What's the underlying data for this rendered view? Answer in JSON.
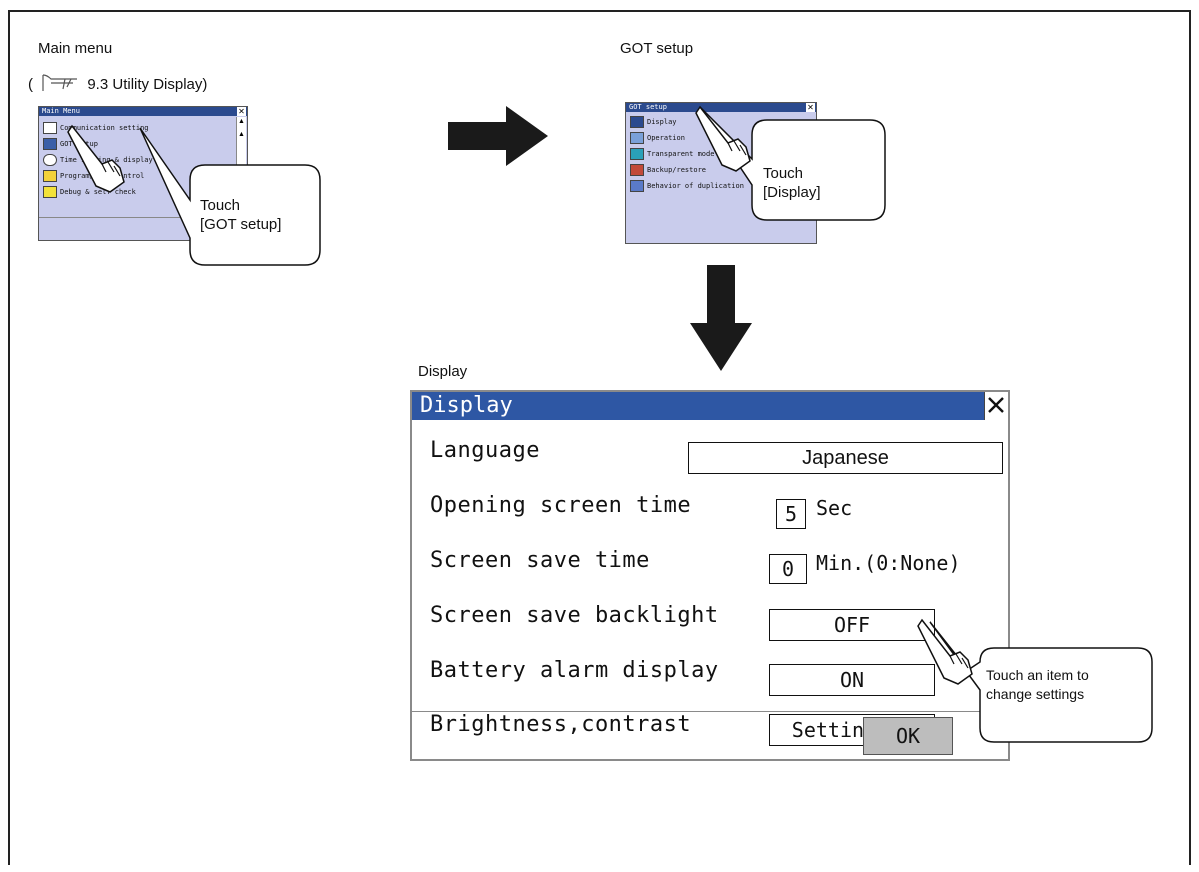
{
  "captions": {
    "main_menu": "Main menu",
    "ref_prefix": "(",
    "ref_text": "9.3 Utility Display)",
    "got_setup": "GOT setup",
    "display": "Display"
  },
  "main_menu_thumb": {
    "title": "Main Menu",
    "items": [
      "Communication setting",
      "GOT setup",
      "Time setting & display",
      "Program/Data control",
      "Debug & self check"
    ],
    "callout": [
      "Touch",
      "[GOT setup]"
    ]
  },
  "got_setup_thumb": {
    "title": "GOT setup",
    "items": [
      "Display",
      "Operation",
      "Transparent mode",
      "Backup/restore",
      "Behavior of duplication"
    ],
    "callout": [
      "Touch",
      "[Display]"
    ]
  },
  "display_dialog": {
    "title": "Display",
    "rows": {
      "language": {
        "label": "Language",
        "value": "Japanese"
      },
      "opening": {
        "label": "Opening screen time",
        "value": "5",
        "unit": "Sec"
      },
      "save_time": {
        "label": "Screen save time",
        "value": "0",
        "unit": "Min.(0:None)"
      },
      "backlight": {
        "label": "Screen save backlight",
        "value": "OFF"
      },
      "battery": {
        "label": "Battery alarm display",
        "value": "ON"
      },
      "brightness": {
        "label": "Brightness,contrast",
        "value": "Setting..."
      }
    },
    "ok_label": "OK",
    "callout": [
      "Touch an item to",
      "change settings"
    ]
  },
  "colors": {
    "title_bar": "#2e57a4",
    "thumb_bg": "#c9ccec",
    "arrow": "#1a1a1a"
  }
}
